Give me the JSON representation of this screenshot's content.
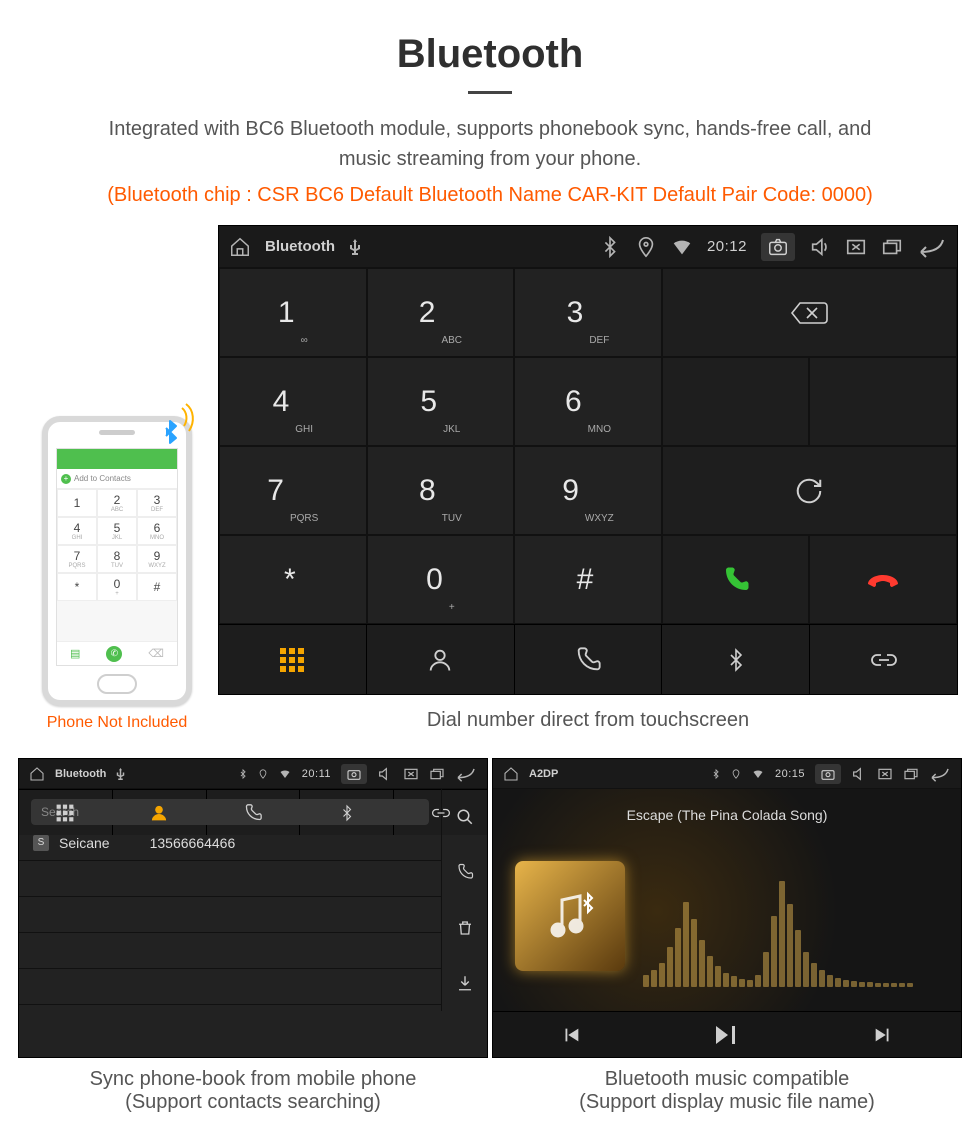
{
  "heading": "Bluetooth",
  "subtitle": "Integrated with BC6 Bluetooth module, supports phonebook sync, hands-free call, and music streaming from your phone.",
  "specs": "(Bluetooth chip : CSR BC6     Default Bluetooth Name CAR-KIT     Default Pair Code: 0000)",
  "phone": {
    "add_contacts": "Add to Contacts",
    "note": "Phone Not Included"
  },
  "main_panel": {
    "app": "Bluetooth",
    "time": "20:12",
    "caption": "Dial number direct from touchscreen",
    "keys": [
      {
        "n": "1",
        "l": "∞"
      },
      {
        "n": "2",
        "l": "ABC"
      },
      {
        "n": "3",
        "l": "DEF"
      },
      {
        "n": "4",
        "l": "GHI"
      },
      {
        "n": "5",
        "l": "JKL"
      },
      {
        "n": "6",
        "l": "MNO"
      },
      {
        "n": "7",
        "l": "PQRS"
      },
      {
        "n": "8",
        "l": "TUV"
      },
      {
        "n": "9",
        "l": "WXYZ"
      },
      {
        "n": "*",
        "l": ""
      },
      {
        "n": "0",
        "l": "+"
      },
      {
        "n": "#",
        "l": ""
      }
    ]
  },
  "phonebook_panel": {
    "app": "Bluetooth",
    "time": "20:11",
    "search_placeholder": "Search",
    "contact_badge": "S",
    "contact_name": "Seicane",
    "contact_number": "13566664466",
    "caption_l1": "Sync phone-book from mobile phone",
    "caption_l2": "(Support contacts searching)"
  },
  "music_panel": {
    "app": "A2DP",
    "time": "20:15",
    "song": "Escape (The Pina Colada Song)",
    "caption_l1": "Bluetooth music compatible",
    "caption_l2": "(Support display music file name)"
  }
}
